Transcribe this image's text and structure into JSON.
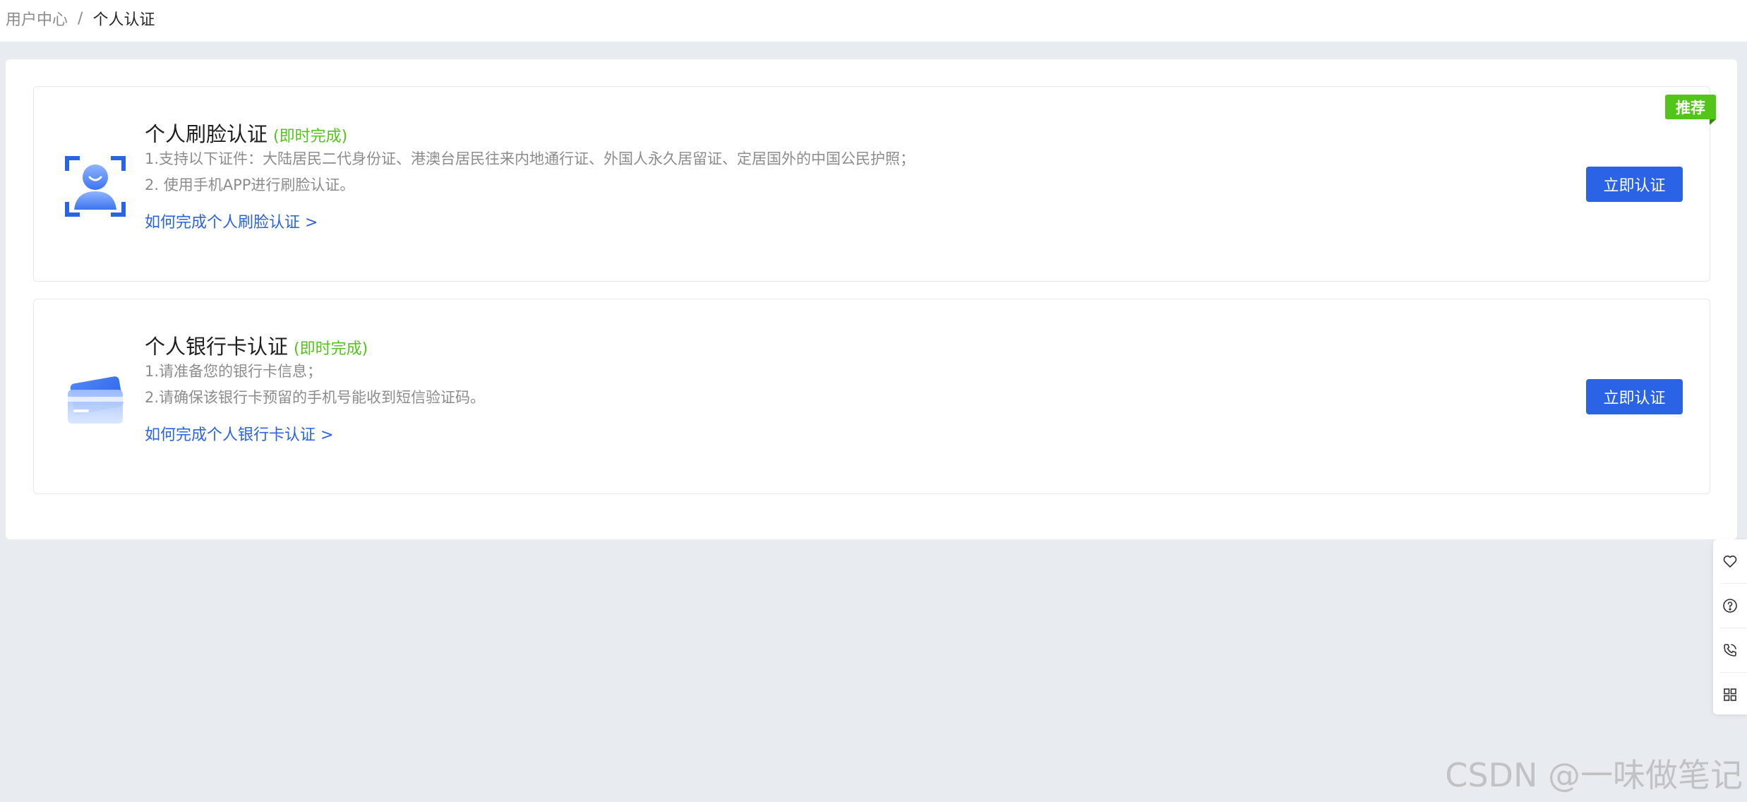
{
  "breadcrumb": {
    "parent": "用户中心",
    "separator": "/",
    "current": "个人认证"
  },
  "cards": [
    {
      "title": "个人刷脸认证",
      "tag": "(即时完成)",
      "badge": "推荐",
      "icon": "face-recognition-icon",
      "desc": [
        "1.支持以下证件：大陆居民二代身份证、港澳台居民往来内地通行证、外国人永久居留证、定居国外的中国公民护照；",
        "2. 使用手机APP进行刷脸认证。"
      ],
      "link": "如何完成个人刷脸认证 >",
      "button": "立即认证"
    },
    {
      "title": "个人银行卡认证",
      "tag": "(即时完成)",
      "icon": "bank-card-icon",
      "desc": [
        "1.请准备您的银行卡信息；",
        "2.请确保该银行卡预留的手机号能收到短信验证码。"
      ],
      "link": "如何完成个人银行卡认证 >",
      "button": "立即认证"
    }
  ],
  "float_bar": {
    "icons": [
      "heart-icon",
      "help-icon",
      "phone-icon",
      "grid-icon"
    ]
  },
  "watermark": "CSDN @一味做笔记",
  "colors": {
    "primary": "#2b63e7",
    "success": "#52c41a",
    "background": "#e8ebf0"
  }
}
